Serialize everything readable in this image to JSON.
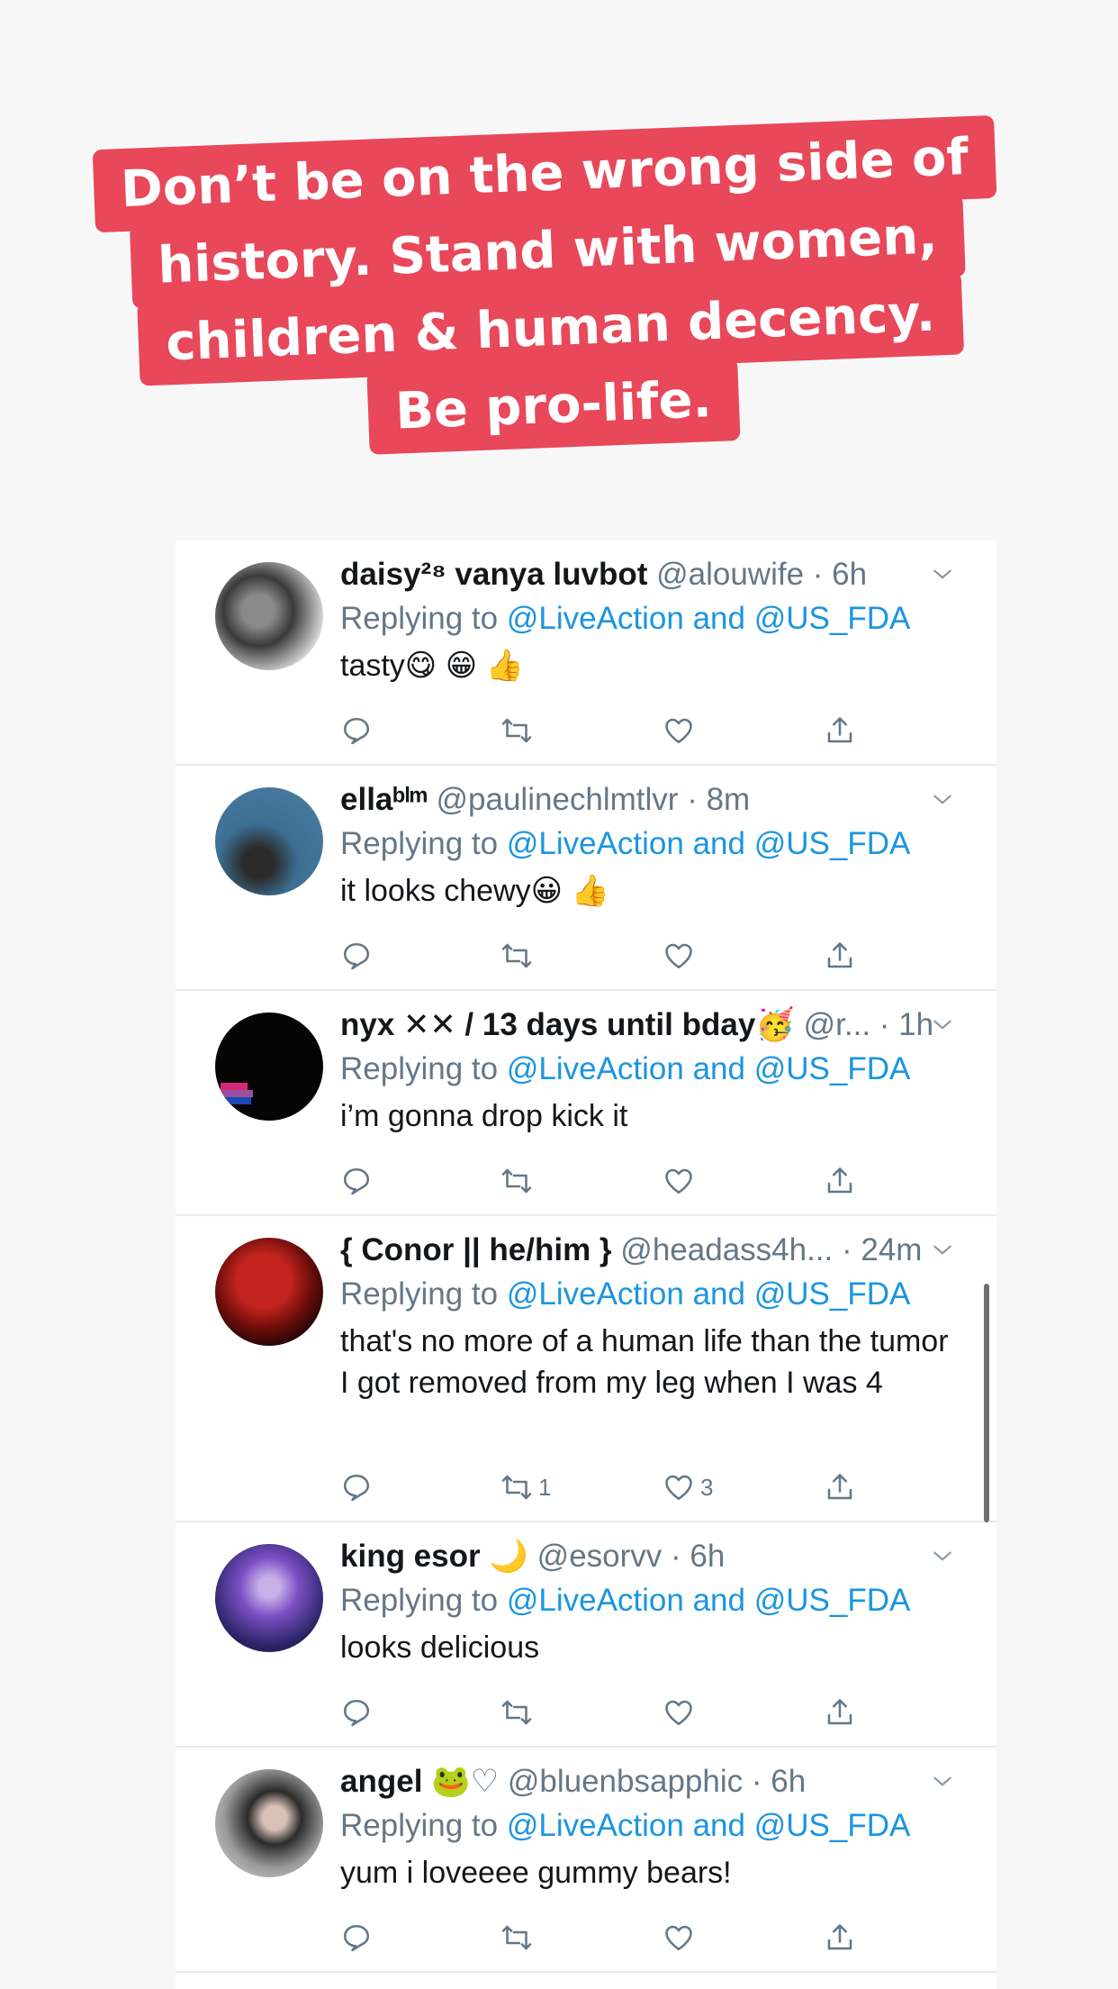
{
  "banner": {
    "lines": [
      "Don’t be on the wrong side of",
      "history. Stand with women,",
      "children & human decency.",
      "Be pro-life."
    ],
    "color": "#e8485a"
  },
  "reply_prefix": "Replying to",
  "reply_targets": "@LiveAction and @US_FDA",
  "tweets": [
    {
      "name": "daisy²⁸ vanya luvbot",
      "name_emoji": "",
      "handle": "@alouwife",
      "time": "· 6h",
      "text": "tasty😋 😁 👍",
      "retweets": "",
      "likes": ""
    },
    {
      "name": "ellaᵇˡᵐ",
      "name_emoji": "",
      "handle": "@paulinechlmtlvr",
      "time": "· 8m",
      "text": "it looks chewy😀 👍",
      "retweets": "",
      "likes": ""
    },
    {
      "name": "nyx ✕✕ / 13 days until bday",
      "name_emoji": "🥳",
      "handle": "@r...",
      "time": "· 1h",
      "text": "i’m gonna drop kick it",
      "retweets": "",
      "likes": ""
    },
    {
      "name": "{ Conor || he/him }",
      "name_emoji": "",
      "handle": "@headass4h...",
      "time": "· 24m",
      "text": "that's no more of a human life than the tumor I got removed from my leg when I was 4",
      "retweets": "1",
      "likes": "3"
    },
    {
      "name": "king esor",
      "name_emoji": "🌙",
      "handle": "@esorvv",
      "time": "· 6h",
      "text": "looks delicious",
      "retweets": "",
      "likes": ""
    },
    {
      "name": "angel",
      "name_emoji": "🐸♡",
      "handle": "@bluenbsapphic",
      "time": "· 6h",
      "text": "yum i loveeee gummy bears!",
      "retweets": "",
      "likes": ""
    }
  ]
}
